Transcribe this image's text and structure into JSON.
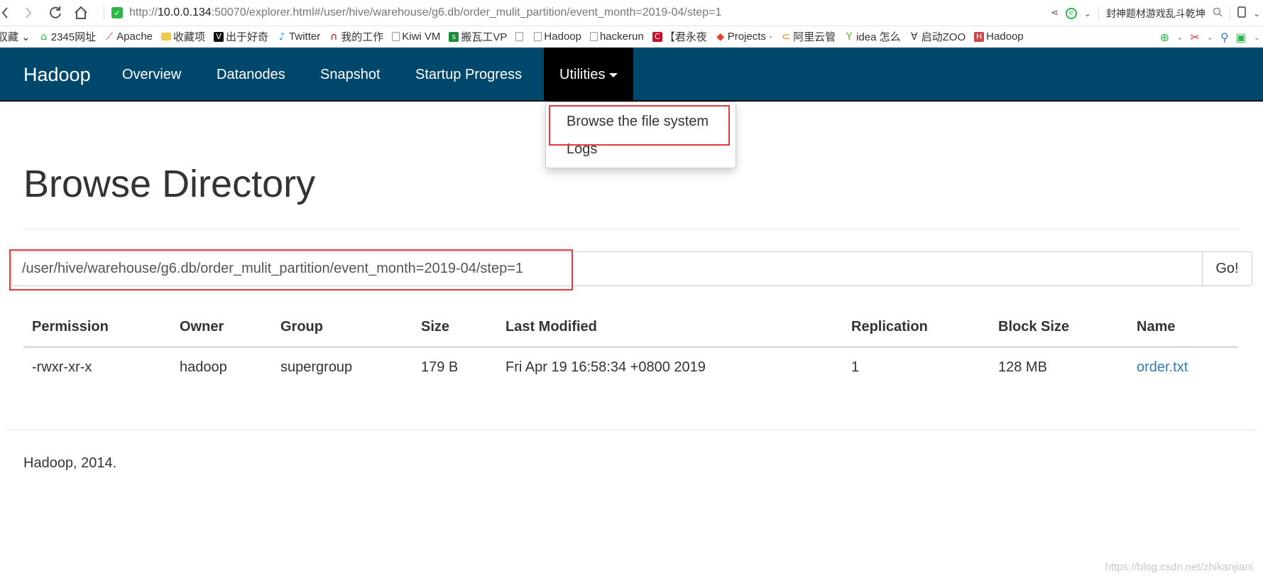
{
  "browser": {
    "url_prefix": "http://",
    "url_host": "10.0.0.134",
    "url_rest": ":50070/explorer.html#/user/hive/warehouse/g6.db/order_mulit_partition/event_month=2019-04/step=1",
    "hot_search": "封神题材游戏乱斗乾坤"
  },
  "bookmarks": [
    {
      "label": "収藏 ⌄",
      "icon": "none"
    },
    {
      "label": "2345网址",
      "icon": "home-icon"
    },
    {
      "label": "Apache",
      "icon": "feather-icon"
    },
    {
      "label": "收藏项",
      "icon": "folder-icon"
    },
    {
      "label": "出于好奇",
      "icon": "vice-icon"
    },
    {
      "label": "Twitter",
      "icon": "twitter-icon"
    },
    {
      "label": "我的工作",
      "icon": "redhat-icon"
    },
    {
      "label": "Kiwi VM",
      "icon": "page-icon"
    },
    {
      "label": "搬瓦工VP",
      "icon": "sheet-icon"
    },
    {
      "label": "",
      "icon": "page-icon"
    },
    {
      "label": "Hadoop",
      "icon": "page-icon"
    },
    {
      "label": "hackerun",
      "icon": "page-icon"
    },
    {
      "label": "【君永夜",
      "icon": "red-c-icon"
    },
    {
      "label": "Projects ·",
      "icon": "gitlab-icon"
    },
    {
      "label": "阿里云管",
      "icon": "aliyun-icon"
    },
    {
      "label": "idea 怎么",
      "icon": "plant-icon"
    },
    {
      "label": "启动ZOO",
      "icon": "zoo-icon"
    },
    {
      "label": "Hadoop",
      "icon": "hadoop-icon"
    }
  ],
  "navbar": {
    "brand": "Hadoop",
    "items": [
      "Overview",
      "Datanodes",
      "Snapshot",
      "Startup Progress"
    ],
    "utilities": "Utilities",
    "color": "#00486b"
  },
  "dropdown": {
    "items": [
      "Browse the file system",
      "Logs"
    ]
  },
  "page": {
    "title": "Browse Directory",
    "path": "/user/hive/warehouse/g6.db/order_mulit_partition/event_month=2019-04/step=1",
    "go_label": "Go!"
  },
  "table": {
    "headers": [
      "Permission",
      "Owner",
      "Group",
      "Size",
      "Last Modified",
      "Replication",
      "Block Size",
      "Name"
    ],
    "rows": [
      [
        "-rwxr-xr-x",
        "hadoop",
        "supergroup",
        "179 B",
        "Fri Apr 19 16:58:34 +0800 2019",
        "1",
        "128 MB",
        "order.txt"
      ]
    ]
  },
  "footer": "Hadoop, 2014.",
  "watermark": "https://blog.csdn.net/zhikanjiani"
}
